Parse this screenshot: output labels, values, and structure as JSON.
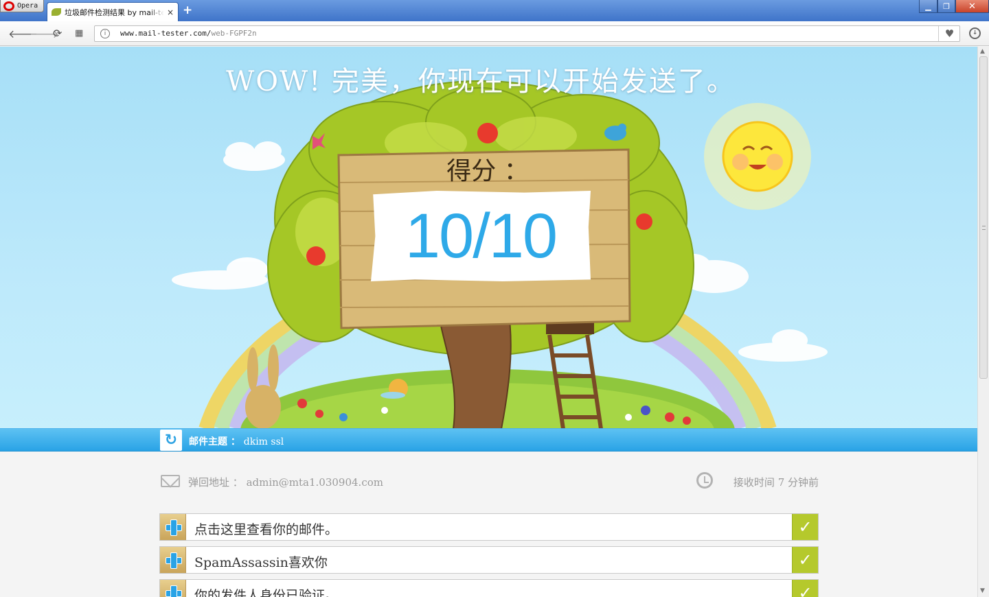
{
  "browser": {
    "menu_label": "Opera",
    "tab_title": "垃圾邮件检测结果 by mail-tester.com",
    "tab_close": "×",
    "new_tab": "+",
    "window_min": "▁",
    "window_max": "❐",
    "window_close": "✕"
  },
  "toolbar": {
    "back_icon": "arrow-left-icon",
    "forward_icon": "arrow-right-icon",
    "reload_icon": "reload-icon",
    "speed_dial_icon": "grid-icon",
    "url_host": "www.mail-tester.com/",
    "url_path": "web-FGPF2n",
    "favorite_icon": "heart-icon",
    "download_icon": "download-icon"
  },
  "hero": {
    "headline": "WOW! 完美，你现在可以开始发送了。",
    "score_label": "得分 ：",
    "score_value": "10/10"
  },
  "subject_bar": {
    "label": "邮件主题 ：",
    "value": "dkim ssl"
  },
  "meta": {
    "bounce_label": "弹回地址 ：",
    "bounce_value": "admin@mta1.030904.com",
    "received_label": "接收时间",
    "received_value": "7 分钟前"
  },
  "checks": [
    {
      "label": "点击这里查看你的邮件。"
    },
    {
      "label": "SpamAssassin喜欢你"
    },
    {
      "label": "你的发件人身份已验证。"
    }
  ],
  "colors": {
    "accent_blue": "#29a3e6",
    "pass_green": "#b5c92c",
    "sky": "#a6dff7"
  }
}
